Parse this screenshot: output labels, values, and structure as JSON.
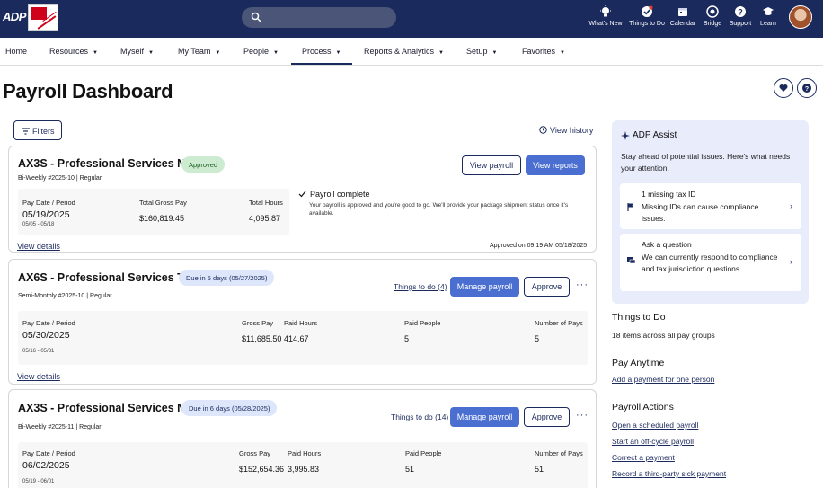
{
  "header": {
    "logo_text": "ADP",
    "icons": [
      {
        "name": "whats-new",
        "label": "What's New"
      },
      {
        "name": "things-to-do",
        "label": "Things to Do"
      },
      {
        "name": "calendar",
        "label": "Calendar"
      },
      {
        "name": "bridge",
        "label": "Bridge"
      },
      {
        "name": "support",
        "label": "Support"
      },
      {
        "name": "learn",
        "label": "Learn"
      }
    ]
  },
  "nav": {
    "items": [
      "Home",
      "Resources",
      "Myself",
      "My Team",
      "People",
      "Process",
      "Reports & Analytics",
      "Setup",
      "Favorites"
    ],
    "active": "Process"
  },
  "page": {
    "title": "Payroll Dashboard",
    "filters_label": "Filters",
    "view_history_label": "View history"
  },
  "cards": [
    {
      "title": "AX3S - Professional Services N...",
      "badge": "Approved",
      "subtitle": "Bi-Weekly #2025-10 | Regular",
      "btn_view_payroll": "View payroll",
      "btn_view_reports": "View reports",
      "pay_date_label": "Pay Date / Period",
      "pay_date": "05/19/2025",
      "period": "05/05 - 05/18",
      "gross_label": "Total Gross Pay",
      "gross": "$160,819.45",
      "hours_label": "Total Hours",
      "hours": "4,095.87",
      "status_title": "Payroll complete",
      "status_text": "Your payroll is approved and you're good to go. We'll provide your package shipment status once it's available.",
      "view_details": "View details",
      "approved_on": "Approved on 09:19 AM 05/18/2025"
    },
    {
      "title": "AX6S - Professional Services T...",
      "badge": "Due in 5 days (05/27/2025)",
      "subtitle": "Semi-Monthly #2025-10 | Regular",
      "things_to_do": "Things to do (4)",
      "btn_manage": "Manage payroll",
      "btn_approve": "Approve",
      "more": "···",
      "pay_date_label": "Pay Date / Period",
      "pay_date": "05/30/2025",
      "period": "05/16 - 05/31",
      "gross_label": "Gross Pay",
      "gross": "$11,685.50",
      "hours_label": "Paid Hours",
      "hours": "414.67",
      "people_label": "Paid People",
      "people": "5",
      "num_pays_label": "Number of Pays",
      "num_pays": "5",
      "view_details": "View details"
    },
    {
      "title": "AX3S - Professional Services N...",
      "badge": "Due in 6 days (05/28/2025)",
      "subtitle": "Bi-Weekly #2025-11 | Regular",
      "things_to_do": "Things to do (14)",
      "btn_manage": "Manage payroll",
      "btn_approve": "Approve",
      "more": "···",
      "pay_date_label": "Pay Date / Period",
      "pay_date": "06/02/2025",
      "period": "05/19 - 06/01",
      "gross_label": "Gross Pay",
      "gross": "$152,654.36",
      "hours_label": "Paid Hours",
      "hours": "3,995.83",
      "people_label": "Paid People",
      "people": "51",
      "num_pays_label": "Number of Pays",
      "num_pays": "51"
    }
  ],
  "assist": {
    "title": "ADP Assist",
    "desc": "Stay ahead of potential issues. Here's what needs your attention.",
    "items": [
      {
        "title": "1 missing tax ID",
        "text": "Missing IDs can cause compliance issues."
      },
      {
        "title": "Ask a question",
        "text": "We can currently respond to compliance and tax jurisdiction questions."
      }
    ]
  },
  "sidebar": {
    "things_heading": "Things to Do",
    "things_text": "18 items across all pay groups",
    "pay_anytime_heading": "Pay Anytime",
    "pay_anytime_link": "Add a payment for one person",
    "actions_heading": "Payroll Actions",
    "actions": [
      "Open a scheduled payroll",
      "Start an off-cycle payroll",
      "Correct a payment",
      "Record a third-party sick payment"
    ]
  },
  "colors": {
    "header_bg": "#1b2a5c",
    "primary_button": "#4a6fd1",
    "approved_badge": "#cdebd0",
    "due_badge": "#dde6fb",
    "assist_bg": "#e8ecfb"
  }
}
